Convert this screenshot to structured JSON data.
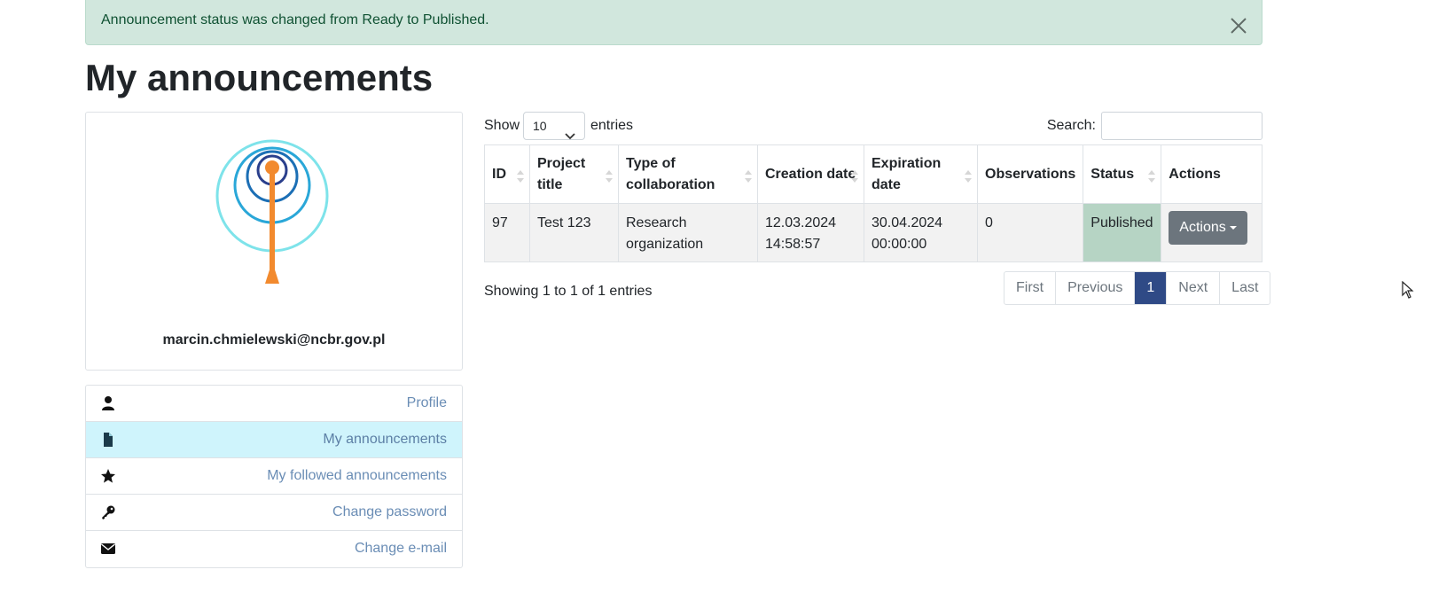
{
  "alert": {
    "message": "Announcement status was changed from Ready to Published.",
    "close_icon": "close-icon"
  },
  "page": {
    "title": "My announcements"
  },
  "profile": {
    "logo_icon": "antenna-logo",
    "email": "marcin.chmielewski@ncbr.gov.pl"
  },
  "menu": {
    "items": [
      {
        "label": "Profile",
        "icon": "user-icon",
        "active": false
      },
      {
        "label": "My announcements",
        "icon": "file-icon",
        "active": true
      },
      {
        "label": "My followed announcements",
        "icon": "star-icon",
        "active": false
      },
      {
        "label": "Change password",
        "icon": "key-icon",
        "active": false
      },
      {
        "label": "Change e-mail",
        "icon": "envelope-icon",
        "active": false
      }
    ]
  },
  "datatable": {
    "show_label": "Show",
    "length_value": "10",
    "entries_label": "entries",
    "search_label": "Search:",
    "search_value": "",
    "columns": [
      "ID",
      "Project title",
      "Type of collaboration",
      "Creation date",
      "Expiration date",
      "Observations",
      "Status",
      "Actions"
    ],
    "rows": [
      {
        "id": "97",
        "project_title": "Test 123",
        "type": "Research organization",
        "creation_date": "12.03.2024 14:58:57",
        "expiration_date": "30.04.2024 00:00:00",
        "observations": "0",
        "status": "Published",
        "action_label": "Actions"
      }
    ],
    "info": "Showing 1 to 1 of 1 entries",
    "pagination": {
      "first": "First",
      "previous": "Previous",
      "current": "1",
      "next": "Next",
      "last": "Last"
    }
  },
  "colors": {
    "alert_bg": "#d1e7dd",
    "active_menu_bg": "#cff4fc",
    "status_bg": "#b6d4c4",
    "page_active": "#2f4a86",
    "button_secondary": "#6c757d"
  }
}
